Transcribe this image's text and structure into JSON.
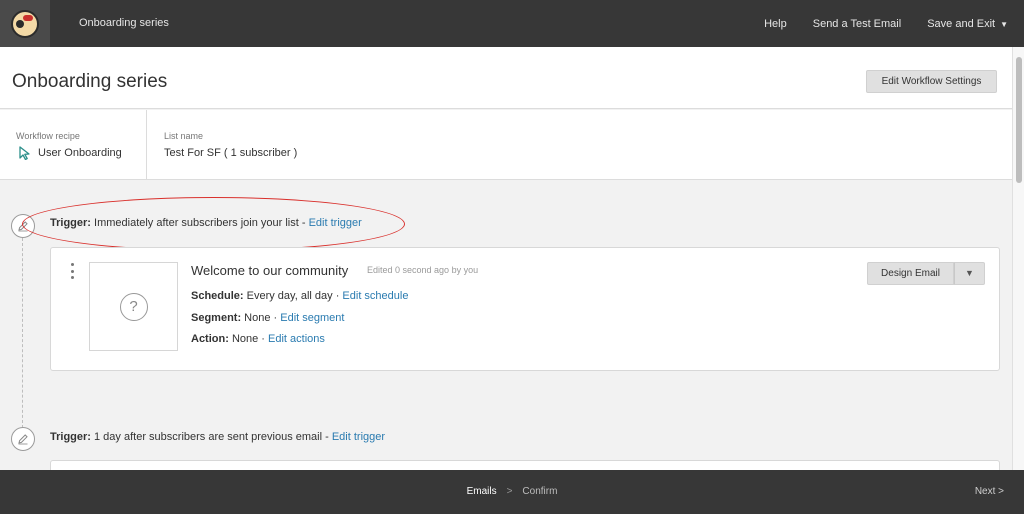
{
  "topbar": {
    "title": "Onboarding series",
    "nav": {
      "help": "Help",
      "test_email": "Send a Test Email",
      "save_exit": "Save and Exit"
    }
  },
  "header": {
    "title": "Onboarding series",
    "settings_button": "Edit Workflow Settings"
  },
  "meta": {
    "recipe_label": "Workflow recipe",
    "recipe_value": "User Onboarding",
    "list_label": "List name",
    "list_value": "Test For SF ( 1 subscriber )"
  },
  "trigger1": {
    "label": "Trigger:",
    "text": " Immediately after subscribers join your list - ",
    "link": "Edit trigger"
  },
  "email": {
    "title": "Welcome to our community",
    "edited": "Edited 0 second ago by you",
    "schedule_label": "Schedule:",
    "schedule_value": " Every day, all day · ",
    "schedule_link": "Edit schedule",
    "segment_label": "Segment:",
    "segment_value": " None · ",
    "segment_link": "Edit segment",
    "action_label": "Action:",
    "action_value": " None · ",
    "action_link": "Edit actions",
    "design_button": "Design Email",
    "thumb_placeholder": "?"
  },
  "trigger2": {
    "label": "Trigger:",
    "text": " 1 day after subscribers are sent previous email - ",
    "link": "Edit trigger"
  },
  "bottombar": {
    "step_emails": "Emails",
    "step_confirm": "Confirm",
    "separator": ">",
    "next": "Next",
    "next_arrow": ">"
  },
  "colors": {
    "bar": "#373737",
    "link": "#2a7bb0",
    "annotation": "#d9302c"
  },
  "icons": [
    "mailchimp-logo",
    "chevron-down-icon",
    "cursor-icon",
    "pencil-icon",
    "more-vertical-icon",
    "question-icon",
    "chevron-right-icon"
  ]
}
